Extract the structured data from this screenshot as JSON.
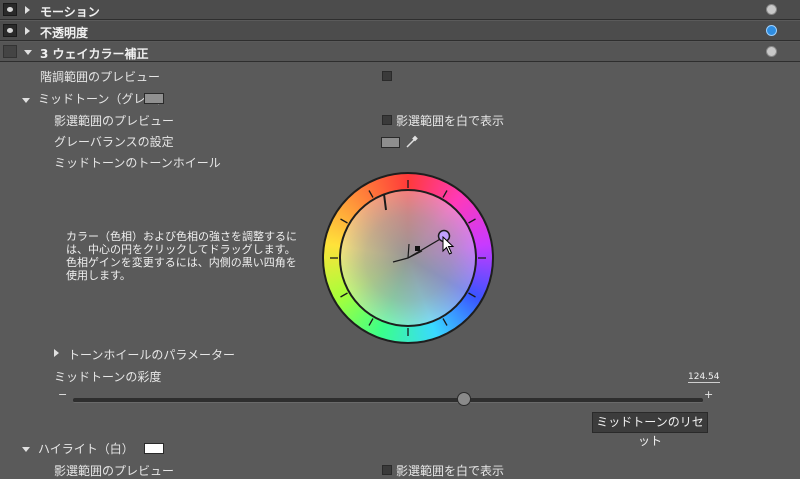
{
  "headers": [
    {
      "title": "モーション",
      "expanded": false,
      "visible": true
    },
    {
      "title": "不透明度",
      "expanded": false,
      "visible": true
    },
    {
      "title": "3 ウェイカラー補正",
      "expanded": true,
      "visible": false
    }
  ],
  "tonal_range_preview": {
    "label": "階調範囲のプレビュー"
  },
  "midtone": {
    "section_label": "ミッドトーン（グレー）",
    "swatch_color": "#909090",
    "mask_preview_label": "影選範囲のプレビュー",
    "mask_white_label": "影選範囲を白で表示",
    "gray_balance_label": "グレーバランスの設定",
    "tone_wheel_label": "ミッドトーンのトーンホイール",
    "help_text": "カラー（色相）および色相の強さを調整するには、中心の円をクリックしてドラッグします。色相ゲインを変更するには、内側の黒い四角を使用します。",
    "wheel_params_label": "トーンホイールのパラメーター",
    "saturation_label": "ミッドトーンの彩度",
    "saturation_value_text": "124.54",
    "saturation_fraction": 0.62,
    "minus": "−",
    "plus": "+",
    "reset_label": "ミッドトーンのリセット"
  },
  "highlight": {
    "section_label": "ハイライト（白）",
    "swatch_color": "#ffffff",
    "mask_preview_label": "影選範囲のプレビュー",
    "mask_white_label": "影選範囲を白で表示"
  },
  "icons": {
    "visibility": "eye-icon",
    "reset": "reset-icon",
    "eyedropper": "eyedropper-icon",
    "cursor": "arrow-cursor-icon"
  }
}
